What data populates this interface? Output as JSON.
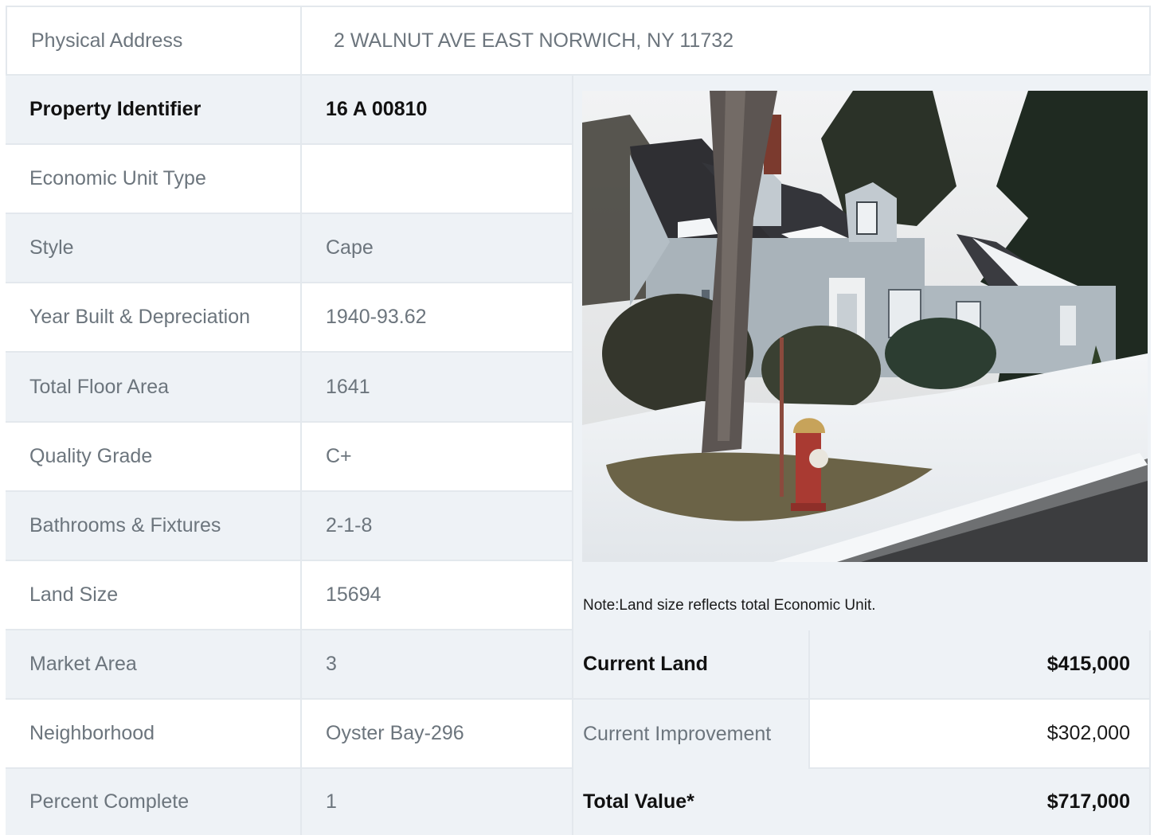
{
  "address": {
    "label": "Physical Address",
    "value": "2  WALNUT AVE  EAST NORWICH, NY  11732"
  },
  "details": [
    {
      "label": "Property Identifier",
      "value": "16  A  00810"
    },
    {
      "label": "Economic Unit Type",
      "value": ""
    },
    {
      "label": "Style",
      "value": "Cape"
    },
    {
      "label": "Year Built & Depreciation",
      "value": "1940-93.62"
    },
    {
      "label": "Total Floor Area",
      "value": "1641"
    },
    {
      "label": "Quality Grade",
      "value": "C+"
    },
    {
      "label": "Bathrooms & Fixtures",
      "value": "2-1-8"
    },
    {
      "label": "Land Size",
      "value": "15694"
    },
    {
      "label": "Market Area",
      "value": "3"
    },
    {
      "label": "Neighborhood",
      "value": "Oyster Bay-296"
    },
    {
      "label": "Percent Complete",
      "value": "1"
    }
  ],
  "note": "Note:Land size reflects total Economic Unit.",
  "values": [
    {
      "label": "Current Land",
      "value": "$415,000"
    },
    {
      "label": "Current Improvement",
      "value": "$302,000"
    },
    {
      "label": "Total Value*",
      "value": "$717,000"
    }
  ],
  "colors": {
    "shaded_row": "#eef2f6",
    "border": "#e3e8ed",
    "muted_text": "#6c757d"
  }
}
